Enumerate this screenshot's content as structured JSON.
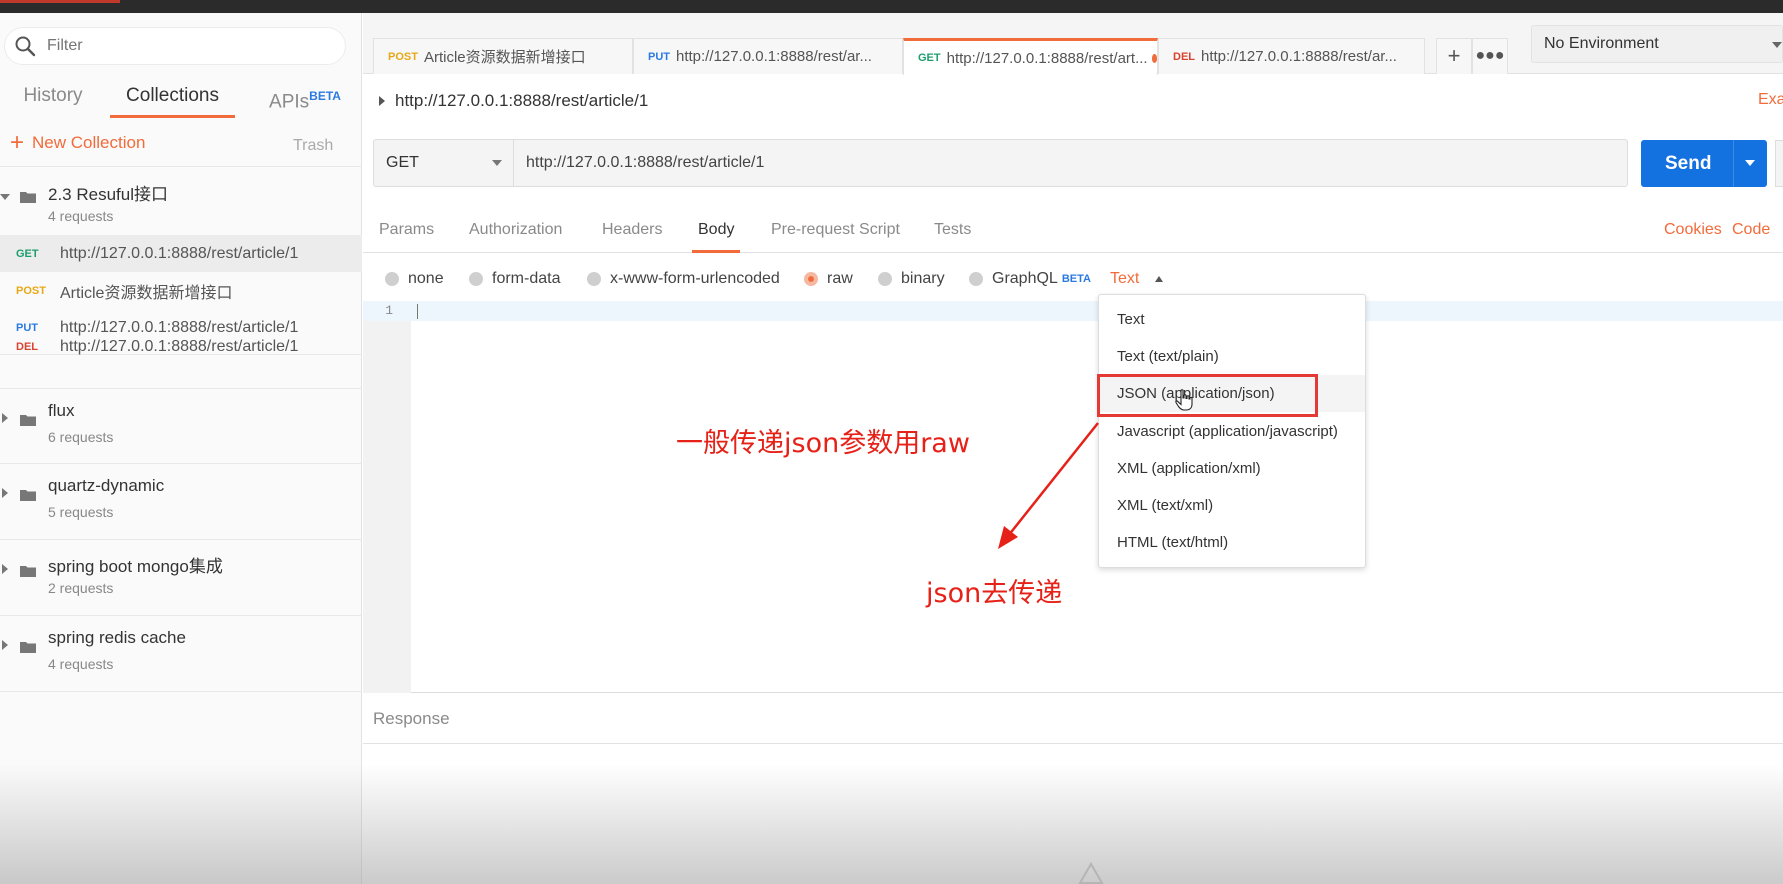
{
  "sidebar": {
    "filter_placeholder": "Filter",
    "tabs": [
      {
        "label": "History"
      },
      {
        "label": "Collections"
      },
      {
        "label": "APIs",
        "badge": "BETA"
      }
    ],
    "new_collection_label": "New Collection",
    "trash_label": "Trash",
    "collections": [
      {
        "name": "2.3 Resuful接口",
        "count": "4 requests",
        "expanded": true,
        "requests": [
          {
            "method": "GET",
            "url": "http://127.0.0.1:8888/rest/article/1"
          },
          {
            "method": "POST",
            "url": "Article资源数据新增接口"
          },
          {
            "method": "PUT",
            "url": "http://127.0.0.1:8888/rest/article/1"
          },
          {
            "method": "DEL",
            "url": "http://127.0.0.1:8888/rest/article/1"
          }
        ]
      },
      {
        "name": "flux",
        "count": "6 requests"
      },
      {
        "name": "quartz-dynamic",
        "count": "5 requests"
      },
      {
        "name": "spring boot mongo集成",
        "count": "2 requests"
      },
      {
        "name": "spring redis cache",
        "count": "4 requests"
      }
    ]
  },
  "tabs": [
    {
      "method": "POST",
      "label": "Article资源数据新增接口"
    },
    {
      "method": "PUT",
      "label": "http://127.0.0.1:8888/rest/ar..."
    },
    {
      "method": "GET",
      "label": "http://127.0.0.1:8888/rest/art...",
      "unsaved": true
    },
    {
      "method": "DEL",
      "label": "http://127.0.0.1:8888/rest/ar..."
    }
  ],
  "environment": {
    "selected": "No Environment"
  },
  "request": {
    "breadcrumb": "http://127.0.0.1:8888/rest/article/1",
    "examples_label": "Exa",
    "method": "GET",
    "url": "http://127.0.0.1:8888/rest/article/1",
    "send_label": "Send"
  },
  "section_tabs": [
    "Params",
    "Authorization",
    "Headers",
    "Body",
    "Pre-request Script",
    "Tests"
  ],
  "right_links": [
    "Cookies",
    "Code"
  ],
  "body_options": [
    {
      "label": "none"
    },
    {
      "label": "form-data"
    },
    {
      "label": "x-www-form-urlencoded"
    },
    {
      "label": "raw",
      "checked": true
    },
    {
      "label": "binary"
    },
    {
      "label": "GraphQL",
      "badge": "BETA"
    }
  ],
  "body_type": "Text",
  "editor": {
    "line_number": "1"
  },
  "dropdown_options": [
    "Text",
    "Text (text/plain)",
    "JSON (application/json)",
    "Javascript (application/javascript)",
    "XML (application/xml)",
    "XML (text/xml)",
    "HTML (text/html)"
  ],
  "response_label": "Response",
  "annotations": {
    "raw_note": "一般传递json参数用raw",
    "json_note": "json去传递"
  },
  "colors": {
    "accent": "#f26b3a",
    "send": "#1472e0",
    "annotation": "#e62117",
    "get": "#1f9e6e",
    "post": "#e6a915",
    "put": "#2a7ae2",
    "del": "#d9432f"
  }
}
